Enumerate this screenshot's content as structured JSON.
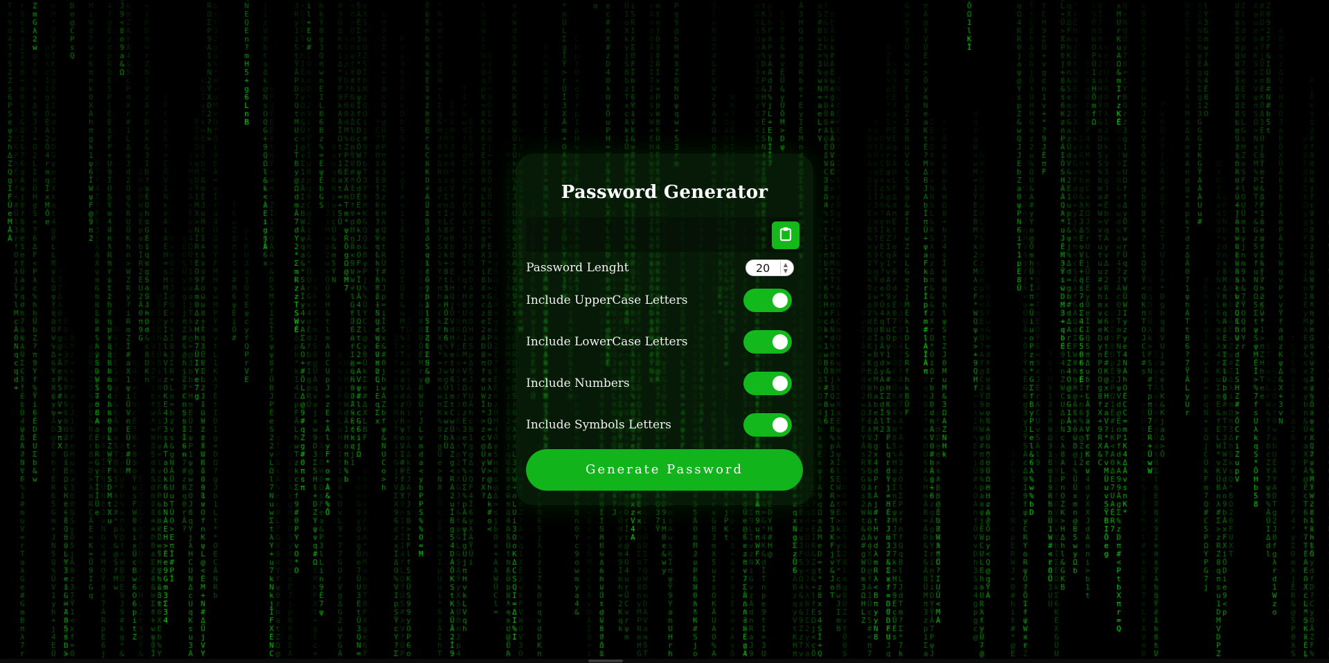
{
  "title": "Password Generator",
  "password": {
    "value": "",
    "copy_icon": "clipboard-icon"
  },
  "options": {
    "length_label": "Password Lenght",
    "length_value": "20",
    "uppercase_label": "Include UpperCase Letters",
    "uppercase_checked": true,
    "lowercase_label": "Include LowerCase Letters",
    "lowercase_checked": true,
    "numbers_label": "Include Numbers",
    "numbers_checked": true,
    "symbols_label": "Include Symbols Letters",
    "symbols_checked": true
  },
  "generate_label": "Generate Password",
  "colors": {
    "accent": "#12b81c",
    "matrix_green": "#1fd11f",
    "background": "#000000"
  }
}
